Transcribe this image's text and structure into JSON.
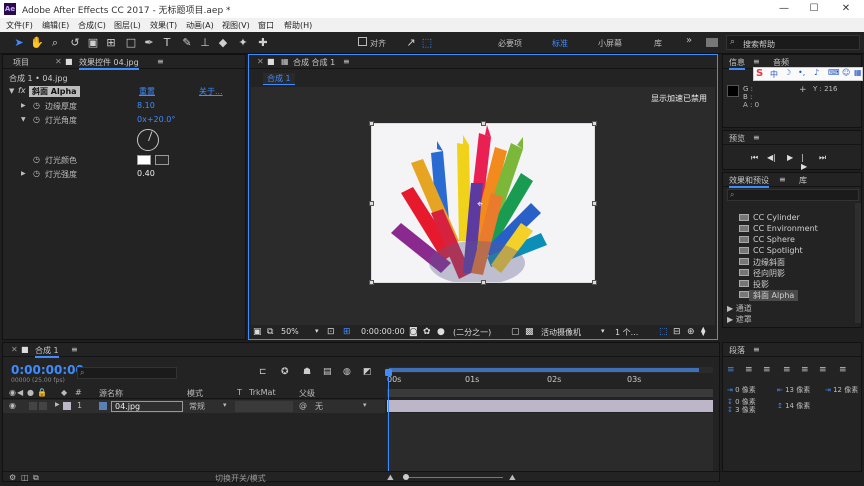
{
  "window": {
    "title": "Adobe After Effects CC 2017 - 无标题项目.aep *",
    "logo": "Ae",
    "minimize": "—",
    "maximize": "☐",
    "close": "✕"
  },
  "menu": [
    "文件(F)",
    "编辑(E)",
    "合成(C)",
    "图层(L)",
    "效果(T)",
    "动画(A)",
    "视图(V)",
    "窗口",
    "帮助(H)"
  ],
  "toolbar": {
    "snap_label": "对齐",
    "workspaces": [
      "必要项",
      "标准",
      "小屏幕",
      "库"
    ],
    "more": "»",
    "search_placeholder": "搜索帮助"
  },
  "left_panel": {
    "tabs": [
      "项目",
      "效果控件 04.jpg"
    ],
    "comp_label": "合成 1 • 04.jpg",
    "effect_name": "斜面 Alpha",
    "reset": "重置",
    "about": "关于...",
    "fx": "fx",
    "props": [
      {
        "label": "边缘厚度",
        "value": "8.10"
      },
      {
        "label": "灯光角度",
        "value": "0x+20.0°"
      },
      {
        "label": "灯光颜色",
        "value": ""
      },
      {
        "label": "灯光强度",
        "value": "0.40"
      }
    ]
  },
  "viewer": {
    "tab": "合成 合成 1",
    "subtab": "合成 1",
    "notice": "显示加速已禁用",
    "zoom": "50%",
    "timecode": "0:00:00:00",
    "resolution": "(二分之一)",
    "camera": "活动摄像机",
    "views": "1 个..."
  },
  "right_panel": {
    "info_tab": "信息",
    "audio_tab": "音频",
    "g": "G :",
    "b": "B :",
    "a": "A : 0",
    "y": "Y : 216",
    "preview_tab": "预览",
    "effects_tab": "效果和预设",
    "library_tab": "库",
    "effects": [
      "CC Cylinder",
      "CC Environment",
      "CC Sphere",
      "CC Spotlight",
      "边缘斜面",
      "径向阴影",
      "投影",
      "斜面 Alpha"
    ],
    "categories": [
      "通道",
      "遮罩"
    ],
    "paragraph_tab": "段落",
    "para": [
      "0 像素",
      "13 像素",
      "12 像素",
      "0 像素",
      "3 像素",
      "14 像素"
    ]
  },
  "timeline": {
    "tab": "合成 1",
    "timecode": "0:00:00:00",
    "frames": "00000 (25.00 fps)",
    "columns": [
      "源名称",
      "模式",
      "T",
      "TrkMat",
      "父级"
    ],
    "layer_num": "1",
    "layer_name": "04.jpg",
    "layer_mode": "常规",
    "layer_parent": "无",
    "ruler": [
      "00s",
      "01s",
      "02s",
      "03s"
    ],
    "footer": "切换开关/模式"
  },
  "colors": {
    "accent": "#3f8cff",
    "bg": "#232323",
    "panel_dark": "#1b1b1b",
    "layer_bar": "#bcb6c8"
  }
}
